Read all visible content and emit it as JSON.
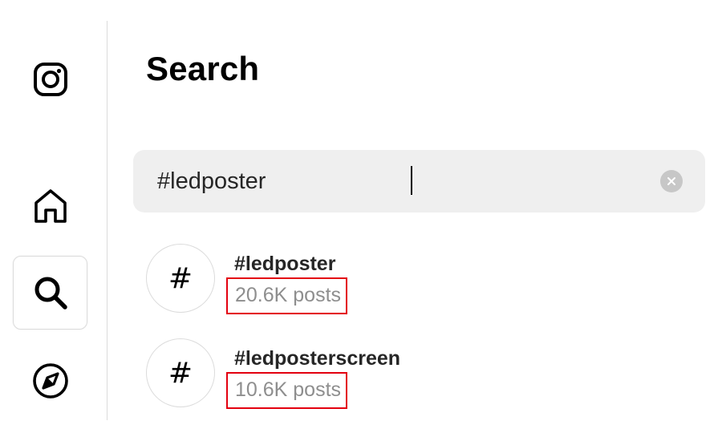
{
  "sidebar": {
    "items": [
      {
        "name": "instagram-logo-icon"
      },
      {
        "name": "home-icon"
      },
      {
        "name": "search-icon"
      },
      {
        "name": "explore-compass-icon"
      }
    ],
    "active_item": "search"
  },
  "search_panel": {
    "title": "Search",
    "search": {
      "value": "#ledposter",
      "clear_icon": "clear-x-icon"
    },
    "results": [
      {
        "symbol": "#",
        "name": "#ledposter",
        "count": "20.6K posts"
      },
      {
        "symbol": "#",
        "name": "#ledposterscreen",
        "count": "10.6K posts"
      }
    ]
  },
  "colors": {
    "highlight_box": "#e3000f",
    "search_bg": "#efefef",
    "secondary_text": "#8e8e8e",
    "divider": "#dbdbdb"
  }
}
